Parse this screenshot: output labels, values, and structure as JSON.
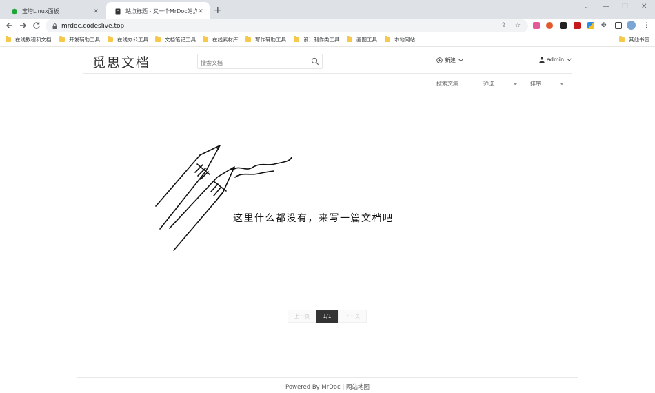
{
  "browser": {
    "tabs": [
      {
        "title": "宝塔Linux面板",
        "active": false
      },
      {
        "title": "站点标题 - 又一个MrDoc站点",
        "active": true
      }
    ],
    "url": "mrdoc.codeslive.top",
    "bookmarks": [
      "在线教程和文档",
      "开发辅助工具",
      "在线办公工具",
      "文档笔记工具",
      "在线素材库",
      "写作辅助工具",
      "设计制作类工具",
      "画图工具",
      "本地网站"
    ],
    "other_bookmarks": "其他书签"
  },
  "header": {
    "logo": "觅思文档",
    "search_placeholder": "搜索文档",
    "new_label": "新建",
    "user_label": "admin"
  },
  "filters": {
    "search_docs": "搜索文集",
    "filter": "筛选",
    "sort": "排序"
  },
  "empty_state": {
    "message": "这里什么都没有，来写一篇文档吧"
  },
  "pagination": {
    "prev": "上一页",
    "current": "1/1",
    "next": "下一页"
  },
  "footer": {
    "powered": "Powered By MrDoc",
    "separator": "|",
    "sitemap": "网站地图"
  },
  "colors": {
    "pagination_active": "#333333",
    "bookmark_folder": "#f6c94c"
  }
}
